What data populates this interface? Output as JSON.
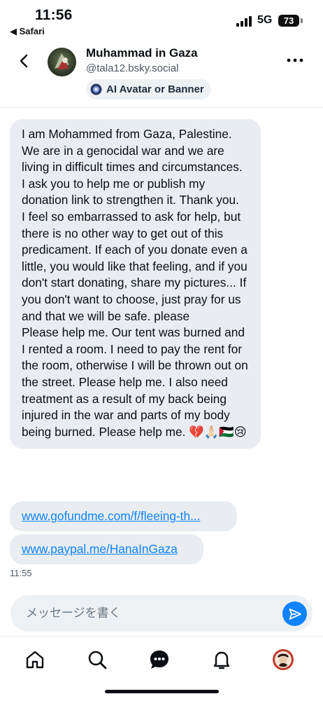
{
  "status_bar": {
    "time": "11:56",
    "back_app": "◀ Safari",
    "network": "5G",
    "battery": "73"
  },
  "header": {
    "name": "Muhammad in Gaza",
    "handle": "@tala12.bsky.social",
    "label": "AI Avatar or Banner",
    "icons": {
      "back": "chevron-left-icon",
      "more": "more-horizontal-icon"
    }
  },
  "messages": {
    "main_text": "I am Mohammed from Gaza, Palestine. We are in a genocidal war and we are living in difficult times and circumstances. I ask you to help me or publish my donation link to strengthen it. Thank you.\nI feel so embarrassed to ask for help, but there is no other way to get out of this predicament. If each of you donate even a little, you would like that feeling, and if you don't start donating, share my pictures... If you don't want to choose, just pray for us and that we will be safe. please\nPlease help me. Our tent was burned and I rented a room. I need to pay the rent for the room, otherwise I will be thrown out on the street. Please help me. I also need treatment as a result of my back being injured in the war and parts of my body being burned. Please help me. 💔🙏🏻🇵🇸😢",
    "link1": "www.gofundme.com/f/fleeing-th...",
    "link2": "www.paypal.me/HanaInGaza",
    "time": "11:55"
  },
  "composer": {
    "placeholder": "メッセージを書く",
    "value": ""
  },
  "tabbar": {
    "items": [
      "home-icon",
      "search-icon",
      "chat-icon",
      "bell-icon",
      "profile-avatar"
    ]
  },
  "colors": {
    "accent": "#1083fe",
    "bubble": "#e9edf1",
    "text": "#0b0f14",
    "muted": "#4b5563"
  }
}
